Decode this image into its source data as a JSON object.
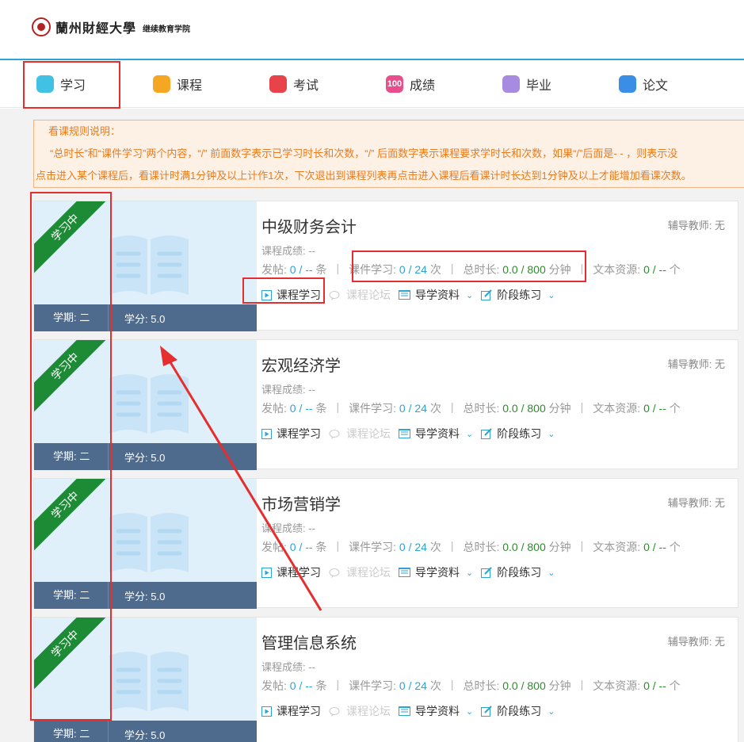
{
  "header": {
    "school_name": "蘭州財經大學",
    "college": "继续教育学院"
  },
  "nav": [
    {
      "label": "学习",
      "icon": "study-icon",
      "color": "#41c1e3"
    },
    {
      "label": "课程",
      "icon": "course-icon",
      "color": "#f5a623"
    },
    {
      "label": "考试",
      "icon": "exam-icon",
      "color": "#e8434a"
    },
    {
      "label": "成绩",
      "icon": "score-icon",
      "color": "#e94d8b",
      "icon_text": "100"
    },
    {
      "label": "毕业",
      "icon": "graduation-icon",
      "color": "#a78be0"
    },
    {
      "label": "论文",
      "icon": "paper-icon",
      "color": "#3a8ee6"
    }
  ],
  "notice": {
    "line1": "看课规则说明：",
    "line2": "“总时长”和“课件学习”两个内容，“/”  前面数字表示已学习时长和次数，“/”  后面数字表示课程要求学时长和次数，如果“/”后面是- - ，则表示没",
    "line3": "点击进入某个课程后，看课计时满1分钟及以上计作1次，下次退出到课程列表再点击进入课程后看课计时长达到1分钟及以上才能增加看课次数。"
  },
  "labels": {
    "status": "学习中",
    "term_prefix": "学期: ",
    "credit_prefix": "学分: ",
    "teacher_prefix": "辅导教师: ",
    "grade_prefix": "课程成绩: ",
    "posts_prefix": "发帖: ",
    "posts_unit": "条",
    "courseware_prefix": "课件学习: ",
    "courseware_unit": "次",
    "duration_prefix": "总时长: ",
    "duration_unit": "分钟",
    "text_prefix": "文本资源: ",
    "text_unit": "个",
    "slash": " / ",
    "btn_study": "课程学习",
    "btn_forum": "课程论坛",
    "btn_guide": "导学资料",
    "btn_practice": "阶段练习"
  },
  "courses": [
    {
      "title": "中级财务会计",
      "teacher": "无",
      "grade": "--",
      "posts_done": "0",
      "posts_req": "--",
      "cw_done": "0",
      "cw_req": "24",
      "dur_done": "0.0",
      "dur_req": "800",
      "text_done": "0",
      "text_req": "--",
      "term": "二",
      "credit": "5.0"
    },
    {
      "title": "宏观经济学",
      "teacher": "无",
      "grade": "--",
      "posts_done": "0",
      "posts_req": "--",
      "cw_done": "0",
      "cw_req": "24",
      "dur_done": "0.0",
      "dur_req": "800",
      "text_done": "0",
      "text_req": "--",
      "term": "二",
      "credit": "5.0"
    },
    {
      "title": "市场营销学",
      "teacher": "无",
      "grade": "--",
      "posts_done": "0",
      "posts_req": "--",
      "cw_done": "0",
      "cw_req": "24",
      "dur_done": "0.0",
      "dur_req": "800",
      "text_done": "0",
      "text_req": "--",
      "term": "二",
      "credit": "5.0"
    },
    {
      "title": "管理信息系统",
      "teacher": "无",
      "grade": "--",
      "posts_done": "0",
      "posts_req": "--",
      "cw_done": "0",
      "cw_req": "24",
      "dur_done": "0.0",
      "dur_req": "800",
      "text_done": "0",
      "text_req": "--",
      "term": "二",
      "credit": "5.0"
    }
  ],
  "colors": {
    "accent": "#2ea3d6",
    "highlight": "#e52e2e",
    "ribbon": "#1d8a35",
    "notice": "#ea7b1c"
  }
}
